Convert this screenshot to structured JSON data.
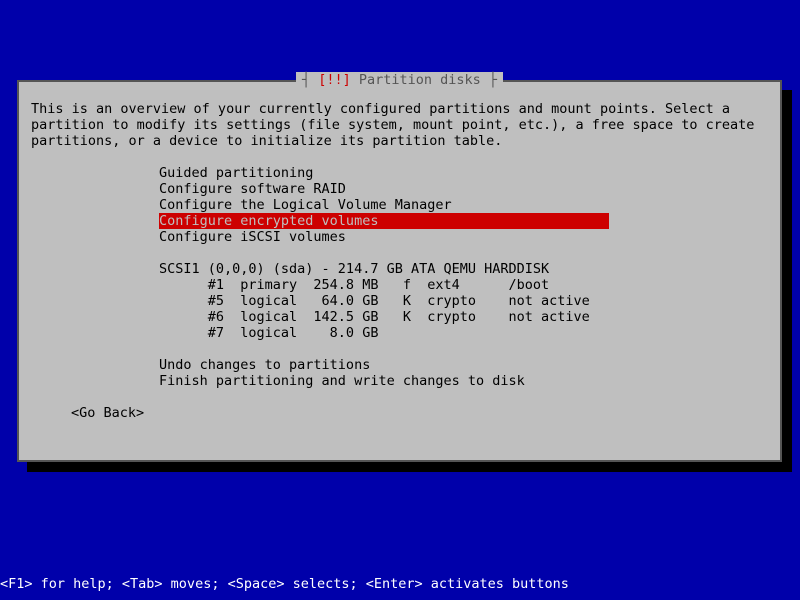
{
  "title": {
    "prefix": "┤",
    "alert": " [!!] ",
    "text": "Partition disks ",
    "suffix": "├"
  },
  "intro": "This is an overview of your currently configured partitions and mount points. Select a\npartition to modify its settings (file system, mount point, etc.), a free space to create\npartitions, or a device to initialize its partition table.",
  "menu": {
    "guided": "Guided partitioning",
    "raid": "Configure software RAID",
    "lvm": "Configure the Logical Volume Manager",
    "encrypted": "Configure encrypted volumes",
    "iscsi": "Configure iSCSI volumes"
  },
  "disk_header": "SCSI1 (0,0,0) (sda) - 214.7 GB ATA QEMU HARDDISK",
  "partitions": {
    "p1": "      #1  primary  254.8 MB   f  ext4      /boot",
    "p5": "      #5  logical   64.0 GB   K  crypto    not active",
    "p6": "      #6  logical  142.5 GB   K  crypto    not active",
    "p7": "      #7  logical    8.0 GB"
  },
  "actions": {
    "undo": "Undo changes to partitions",
    "finish": "Finish partitioning and write changes to disk"
  },
  "go_back": "<Go Back>",
  "helpbar": "<F1> for help; <Tab> moves; <Space> selects; <Enter> activates buttons"
}
